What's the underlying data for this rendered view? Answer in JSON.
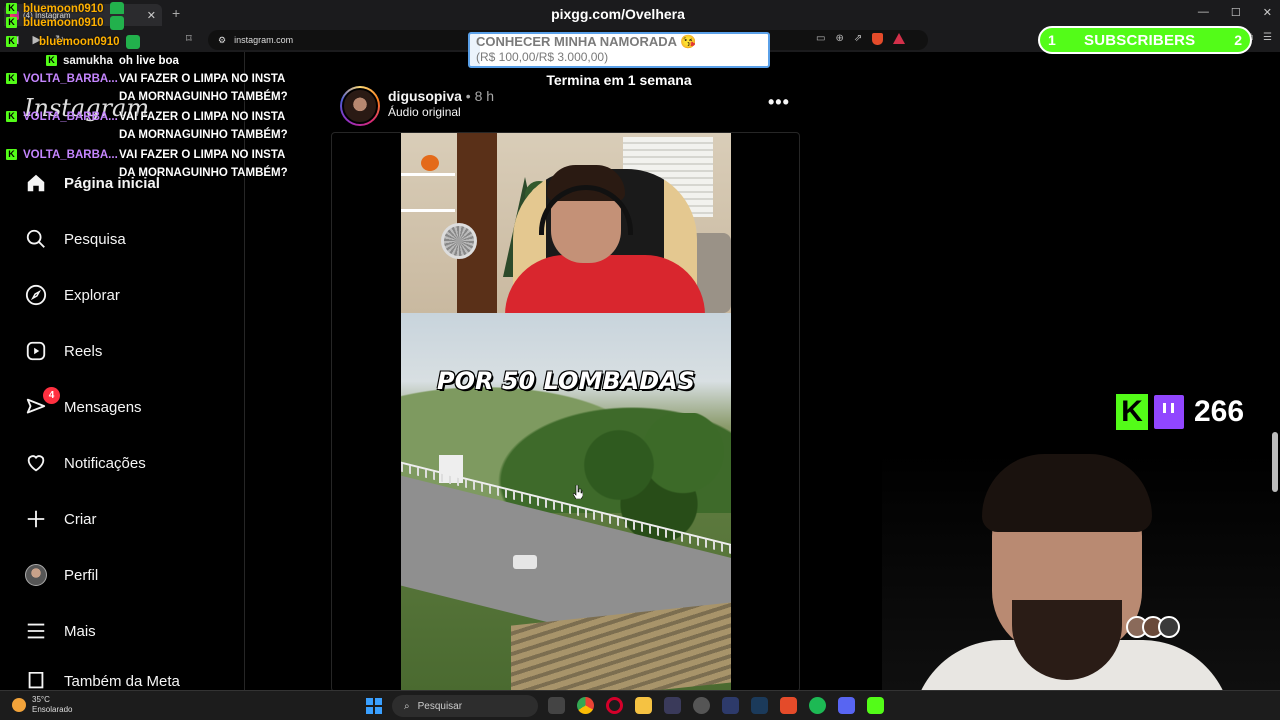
{
  "browser": {
    "tab_title": "(4) Instagram",
    "url": "instagram.com"
  },
  "overlay": {
    "stream_title": "pixgg.com/Ovelhera",
    "goal_line1": "CONHECER MINHA NAMORADA 😘",
    "goal_line2": "(R$ 100,00/R$ 3.000,00)",
    "goal_progress": 0.033,
    "goal_ends": "Termina em 1 semana",
    "subs_count": "1",
    "subs_label": "SUBSCRIBERS",
    "subs_right": "2",
    "viewer_count": "266"
  },
  "chat": [
    {
      "user": "bluemoon0910",
      "color": "yellow",
      "message": ""
    },
    {
      "user": "bluemoon0910",
      "color": "yellow",
      "message": ""
    },
    {
      "user": "bluemoon0910",
      "color": "yellow",
      "message": ""
    },
    {
      "user": "samukha",
      "color": "white",
      "message": "oh live boa"
    },
    {
      "user": "VOLTA_BARBA...",
      "color": "purple",
      "message": "VAI FAZER O LIMPA NO INSTA DA MORNAGUINHO TAMBÉM?"
    },
    {
      "user": "VOLTA_BARBA...",
      "color": "purple",
      "message": "VAI FAZER O LIMPA NO INSTA DA MORNAGUINHO TAMBÉM?"
    },
    {
      "user": "VOLTA_BARBA...",
      "color": "purple",
      "message": "VAI FAZER O LIMPA NO INSTA DA MORNAGUINHO TAMBÉM?"
    }
  ],
  "sidebar": {
    "logo": "Instagram",
    "items": [
      {
        "label": "Página inicial",
        "icon": "home-icon"
      },
      {
        "label": "Pesquisa",
        "icon": "search-icon"
      },
      {
        "label": "Explorar",
        "icon": "compass-icon"
      },
      {
        "label": "Reels",
        "icon": "reels-icon"
      },
      {
        "label": "Mensagens",
        "icon": "messages-icon",
        "badge": "4"
      },
      {
        "label": "Notificações",
        "icon": "heart-icon"
      },
      {
        "label": "Criar",
        "icon": "plus-icon"
      },
      {
        "label": "Perfil",
        "icon": "avatar"
      },
      {
        "label": "Mais",
        "icon": "menu-icon"
      },
      {
        "label": "Também da Meta",
        "icon": "meta-icon"
      }
    ]
  },
  "post": {
    "username": "digusopiva",
    "time": "• 8 h",
    "audio": "Áudio original",
    "video_caption": "POR 50 LOMBADAS"
  },
  "taskbar": {
    "temperature": "35°C",
    "weather": "Ensolarado",
    "search_placeholder": "Pesquisar"
  }
}
